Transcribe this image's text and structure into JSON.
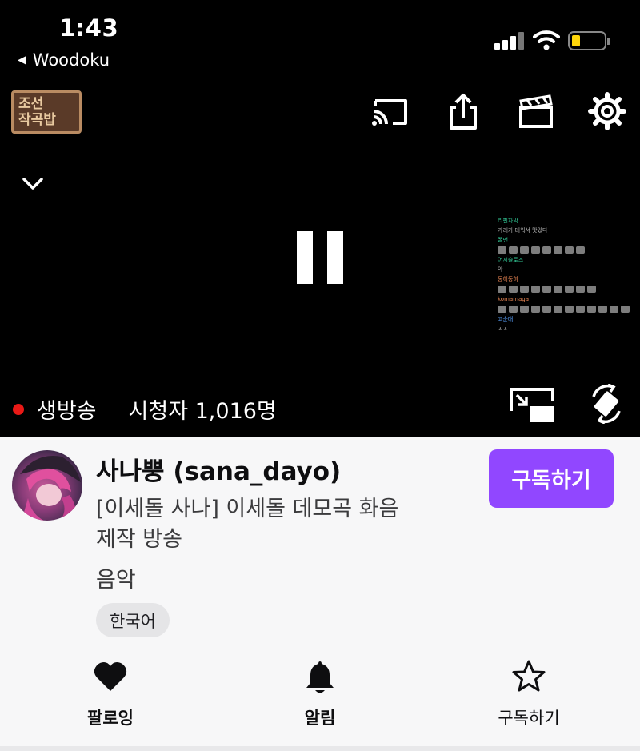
{
  "status_bar": {
    "time": "1:43",
    "back_app": "Woodoku"
  },
  "player": {
    "thumbnail_logo": [
      "조선",
      "작곡밥"
    ],
    "live_label": "생방송",
    "viewers": "시청자 1,016명",
    "chat_overlay": [
      {
        "kind": "name",
        "text": "리핀자막",
        "color": "green"
      },
      {
        "kind": "msg",
        "text": "가래가 테워서 맛있다"
      },
      {
        "kind": "name",
        "text": "꿀맨",
        "color": "green"
      },
      {
        "kind": "emotes",
        "count": 8
      },
      {
        "kind": "name",
        "text": "어시슬로즈",
        "color": "green"
      },
      {
        "kind": "msg",
        "text": "악"
      },
      {
        "kind": "name",
        "text": "동히동히",
        "color": "orange"
      },
      {
        "kind": "emotes",
        "count": 9
      },
      {
        "kind": "name",
        "text": "komamaga",
        "color": "orange"
      },
      {
        "kind": "emotes",
        "count": 12
      },
      {
        "kind": "name",
        "text": "고순대",
        "color": "blue"
      },
      {
        "kind": "msg",
        "text": "ㅅㅅ"
      }
    ]
  },
  "channel": {
    "streamer": "사나뿡 (sana_dayo)",
    "subscribe_label": "구독하기",
    "title_line1": "[이세돌 사나] 이세돌 데모곡 화음",
    "title_line2": "제작 방송",
    "category": "음악",
    "tag": "한국어"
  },
  "actions": {
    "follow_label": "팔로잉",
    "notify_label": "알림",
    "subscribe_label": "구독하기"
  },
  "colors": {
    "brand_purple": "#9147ff",
    "live_red": "#e91916",
    "battery_yellow": "#ffd60a"
  }
}
